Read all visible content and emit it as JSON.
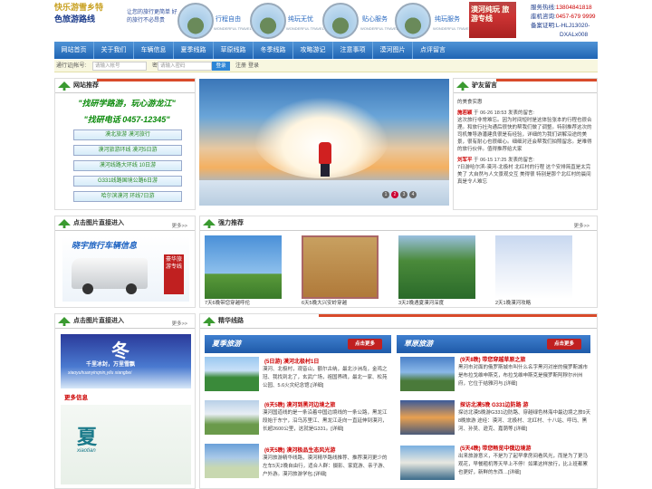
{
  "header": {
    "logo_line1": "快乐游雪乡特",
    "logo_line2": "色旅游路线",
    "slogan": "让您的旅行更简单 好的旅行不必昂贵",
    "circles": [
      {
        "label": "行程自由",
        "sub": "WONDERFUL TRAVEL"
      },
      {
        "label": "纯玩无忧",
        "sub": "WONDERFUL TRAVEL"
      },
      {
        "label": "贴心服务",
        "sub": "WONDERFUL TRAVEL"
      },
      {
        "label": "纯玩服务",
        "sub": "WONDERFUL TRAVEL"
      }
    ],
    "photo_text": "漠河纯玩 旅游专线",
    "contact": [
      {
        "k": "服务热线:",
        "v": "13804841818"
      },
      {
        "k": "座机咨询:",
        "v": "0457-679 9999"
      },
      {
        "k": "备案证明:",
        "v": "L-HLJ13020-"
      },
      {
        "k": "",
        "v": "DXALx008"
      }
    ]
  },
  "nav": [
    "网站首页",
    "关于我们",
    "车辆信息",
    "夏季线路",
    "草原线路",
    "冬季线路",
    "攻略游记",
    "注意事项",
    "漠河图片",
    "点评留言"
  ],
  "login": {
    "label_user": "通行证|帐号:",
    "user_placeholder": "请输入帐号",
    "label_pass": "密码:",
    "pass_placeholder": "请输入密码",
    "login_btn": "登录",
    "register": "注册",
    "login2": "登录"
  },
  "recommend": {
    "title": "网站推荐",
    "slogan1": "\"找研学路游，玩心游龙江\"",
    "slogan2": "\"找研电话 0457-12345\"",
    "items": [
      "漠北旅游 漠河旅行",
      "漠河旅游环线 漠河5日游",
      "漠河线路大环线 10日游",
      "G331线路国境公路6日游",
      "哈尔滨漠河 环线7日游"
    ]
  },
  "slider": {
    "pages": [
      "1",
      "2",
      "3",
      "4"
    ]
  },
  "guestbook": {
    "title": "驴友留言",
    "intro": "的美食实惠",
    "entries": [
      {
        "name": "施若颖",
        "time": "于 06-26 18:53 发表的留言:",
        "body": "这次旅行非常难忘。因为时间短时是这体验张本的行程也很合理。和旅行社沟通后很快的帮我们做了调整。特别推荐这次的司机兼导游潘建良很是有经验，详细的为我们讲解沿途的美景，很有耐心也很细心。细细对还会帮我们拍照留念。是难得的旅行伙伴。值得推荐给大家"
      },
      {
        "name": "刘军平",
        "time": "于 06-15 17:25 发表的留言:",
        "body": "7日游哈尔滨-漠河-北极村 北红村的行程 这个安排简直是太完美了 大自然与人文景观交互 美得很 特别是那个北红村的晨间 真是令人难忘"
      }
    ]
  },
  "click_enter1": {
    "title": "点击图片直接进入",
    "more": "更多>>",
    "banner_text": "晓宇旅行车辆信息",
    "side_text": "豪华旅游专线"
  },
  "strong": {
    "title": "强力推荐",
    "more": "更多>>",
    "items": [
      "7天6晚带您穿越呼伦",
      "6天5晚大兴安岭穿越",
      "3天2晚遇夏漠河深度",
      "2天1晚漠河攻略"
    ]
  },
  "click_enter2": {
    "title": "点击图片直接进入",
    "more": "更多>>",
    "winter": {
      "big": "冬",
      "pinyin": "xiaoyuhuanyinqnin,yilu xiangbei",
      "slogan": "千里冰封，万里雪飘"
    },
    "more_info": "更多信息",
    "summer": {
      "big": "夏",
      "pinyin": "xiaotian"
    }
  },
  "routes": {
    "title": "精华线路",
    "summer_tag": "夏季旅游",
    "grass_tag": "草原旅游",
    "click_more": "点击更多",
    "left": [
      {
        "title": "(5日游) 漠河北极村1日",
        "desc": "漠河、北极村，观音山，额尔古纳，最北沙洲岛，金鸡之冠、我找到北了，玄武广场，祖国界碑，最北一家、松苑公园、5.6火灾纪念馆.[详细]"
      },
      {
        "title": "(6天5晚) 漠河到黑河边境之旅",
        "desc": "漠河国道线的是一条沿着中国边境线的一条公路，黑龙江段始于东宁，沿乌苏里江、黑龙江走向一直延伸到漠河，长超2600公里，这就是G331。[详细]"
      },
      {
        "title": "(6天5晚) 漠河极品生态风光游",
        "desc": "漠河旅游精华线路，漠河精华路线推荐、推荐漠河更少的左车5天2晚自由行，适合人群：摄影、家庭游、亲子游、户外游。漠河旅游学包.[详细]"
      }
    ],
    "right": [
      {
        "title": "(9天8晚) 带您穿越草原之旅",
        "desc": "黑河市对面的俄罗斯城市叫什么名字黑河对岸的俄罗斯城市是布拉戈维申斯克，布拉戈维申斯克是俄罗斯阿穆尔州州府，它位于结雅河与.[详细]"
      },
      {
        "title": "探访北漠5晚 G331边防路 游",
        "desc": "探访北漠5晚游G331边防路、穿越绿色林海中最边境之旅9天8晚旅游 途经：漠河、北极村、北红村、十八站、呼玛、黑河、孙吴、逊克、嘉荫等.[详细]"
      },
      {
        "title": "(5天4晚) 带您畅览中俄边境游",
        "desc": "出来旅游意义，不是为了起早拿房间看风光，而是为了更马观花，早餐粗机等天早上不停！如果这样放行，比上班都累也更好，新鲜的东西…[详细]"
      }
    ]
  }
}
